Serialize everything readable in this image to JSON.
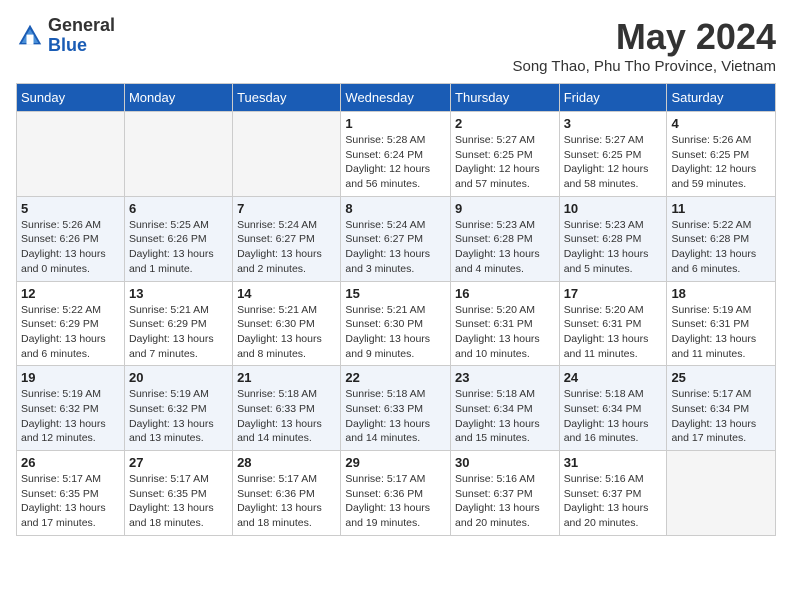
{
  "header": {
    "logo_general": "General",
    "logo_blue": "Blue",
    "month_title": "May 2024",
    "location": "Song Thao, Phu Tho Province, Vietnam"
  },
  "days_of_week": [
    "Sunday",
    "Monday",
    "Tuesday",
    "Wednesday",
    "Thursday",
    "Friday",
    "Saturday"
  ],
  "weeks": [
    [
      {
        "day": "",
        "info": ""
      },
      {
        "day": "",
        "info": ""
      },
      {
        "day": "",
        "info": ""
      },
      {
        "day": "1",
        "info": "Sunrise: 5:28 AM\nSunset: 6:24 PM\nDaylight: 12 hours and 56 minutes."
      },
      {
        "day": "2",
        "info": "Sunrise: 5:27 AM\nSunset: 6:25 PM\nDaylight: 12 hours and 57 minutes."
      },
      {
        "day": "3",
        "info": "Sunrise: 5:27 AM\nSunset: 6:25 PM\nDaylight: 12 hours and 58 minutes."
      },
      {
        "day": "4",
        "info": "Sunrise: 5:26 AM\nSunset: 6:25 PM\nDaylight: 12 hours and 59 minutes."
      }
    ],
    [
      {
        "day": "5",
        "info": "Sunrise: 5:26 AM\nSunset: 6:26 PM\nDaylight: 13 hours and 0 minutes."
      },
      {
        "day": "6",
        "info": "Sunrise: 5:25 AM\nSunset: 6:26 PM\nDaylight: 13 hours and 1 minute."
      },
      {
        "day": "7",
        "info": "Sunrise: 5:24 AM\nSunset: 6:27 PM\nDaylight: 13 hours and 2 minutes."
      },
      {
        "day": "8",
        "info": "Sunrise: 5:24 AM\nSunset: 6:27 PM\nDaylight: 13 hours and 3 minutes."
      },
      {
        "day": "9",
        "info": "Sunrise: 5:23 AM\nSunset: 6:28 PM\nDaylight: 13 hours and 4 minutes."
      },
      {
        "day": "10",
        "info": "Sunrise: 5:23 AM\nSunset: 6:28 PM\nDaylight: 13 hours and 5 minutes."
      },
      {
        "day": "11",
        "info": "Sunrise: 5:22 AM\nSunset: 6:28 PM\nDaylight: 13 hours and 6 minutes."
      }
    ],
    [
      {
        "day": "12",
        "info": "Sunrise: 5:22 AM\nSunset: 6:29 PM\nDaylight: 13 hours and 6 minutes."
      },
      {
        "day": "13",
        "info": "Sunrise: 5:21 AM\nSunset: 6:29 PM\nDaylight: 13 hours and 7 minutes."
      },
      {
        "day": "14",
        "info": "Sunrise: 5:21 AM\nSunset: 6:30 PM\nDaylight: 13 hours and 8 minutes."
      },
      {
        "day": "15",
        "info": "Sunrise: 5:21 AM\nSunset: 6:30 PM\nDaylight: 13 hours and 9 minutes."
      },
      {
        "day": "16",
        "info": "Sunrise: 5:20 AM\nSunset: 6:31 PM\nDaylight: 13 hours and 10 minutes."
      },
      {
        "day": "17",
        "info": "Sunrise: 5:20 AM\nSunset: 6:31 PM\nDaylight: 13 hours and 11 minutes."
      },
      {
        "day": "18",
        "info": "Sunrise: 5:19 AM\nSunset: 6:31 PM\nDaylight: 13 hours and 11 minutes."
      }
    ],
    [
      {
        "day": "19",
        "info": "Sunrise: 5:19 AM\nSunset: 6:32 PM\nDaylight: 13 hours and 12 minutes."
      },
      {
        "day": "20",
        "info": "Sunrise: 5:19 AM\nSunset: 6:32 PM\nDaylight: 13 hours and 13 minutes."
      },
      {
        "day": "21",
        "info": "Sunrise: 5:18 AM\nSunset: 6:33 PM\nDaylight: 13 hours and 14 minutes."
      },
      {
        "day": "22",
        "info": "Sunrise: 5:18 AM\nSunset: 6:33 PM\nDaylight: 13 hours and 14 minutes."
      },
      {
        "day": "23",
        "info": "Sunrise: 5:18 AM\nSunset: 6:34 PM\nDaylight: 13 hours and 15 minutes."
      },
      {
        "day": "24",
        "info": "Sunrise: 5:18 AM\nSunset: 6:34 PM\nDaylight: 13 hours and 16 minutes."
      },
      {
        "day": "25",
        "info": "Sunrise: 5:17 AM\nSunset: 6:34 PM\nDaylight: 13 hours and 17 minutes."
      }
    ],
    [
      {
        "day": "26",
        "info": "Sunrise: 5:17 AM\nSunset: 6:35 PM\nDaylight: 13 hours and 17 minutes."
      },
      {
        "day": "27",
        "info": "Sunrise: 5:17 AM\nSunset: 6:35 PM\nDaylight: 13 hours and 18 minutes."
      },
      {
        "day": "28",
        "info": "Sunrise: 5:17 AM\nSunset: 6:36 PM\nDaylight: 13 hours and 18 minutes."
      },
      {
        "day": "29",
        "info": "Sunrise: 5:17 AM\nSunset: 6:36 PM\nDaylight: 13 hours and 19 minutes."
      },
      {
        "day": "30",
        "info": "Sunrise: 5:16 AM\nSunset: 6:37 PM\nDaylight: 13 hours and 20 minutes."
      },
      {
        "day": "31",
        "info": "Sunrise: 5:16 AM\nSunset: 6:37 PM\nDaylight: 13 hours and 20 minutes."
      },
      {
        "day": "",
        "info": ""
      }
    ]
  ]
}
